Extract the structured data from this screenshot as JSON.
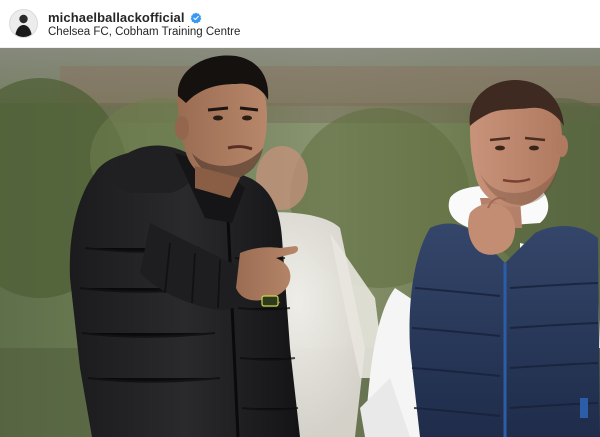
{
  "post": {
    "username": "michaelballackofficial",
    "verified": true,
    "location": "Chelsea FC, Cobham Training Centre",
    "avatar_icon": "profile-avatar",
    "verified_icon": "verified-badge-icon",
    "photo_description_icon": "post-photo"
  },
  "colors": {
    "verified_blue": "#3897f0",
    "text_primary": "#262626"
  }
}
